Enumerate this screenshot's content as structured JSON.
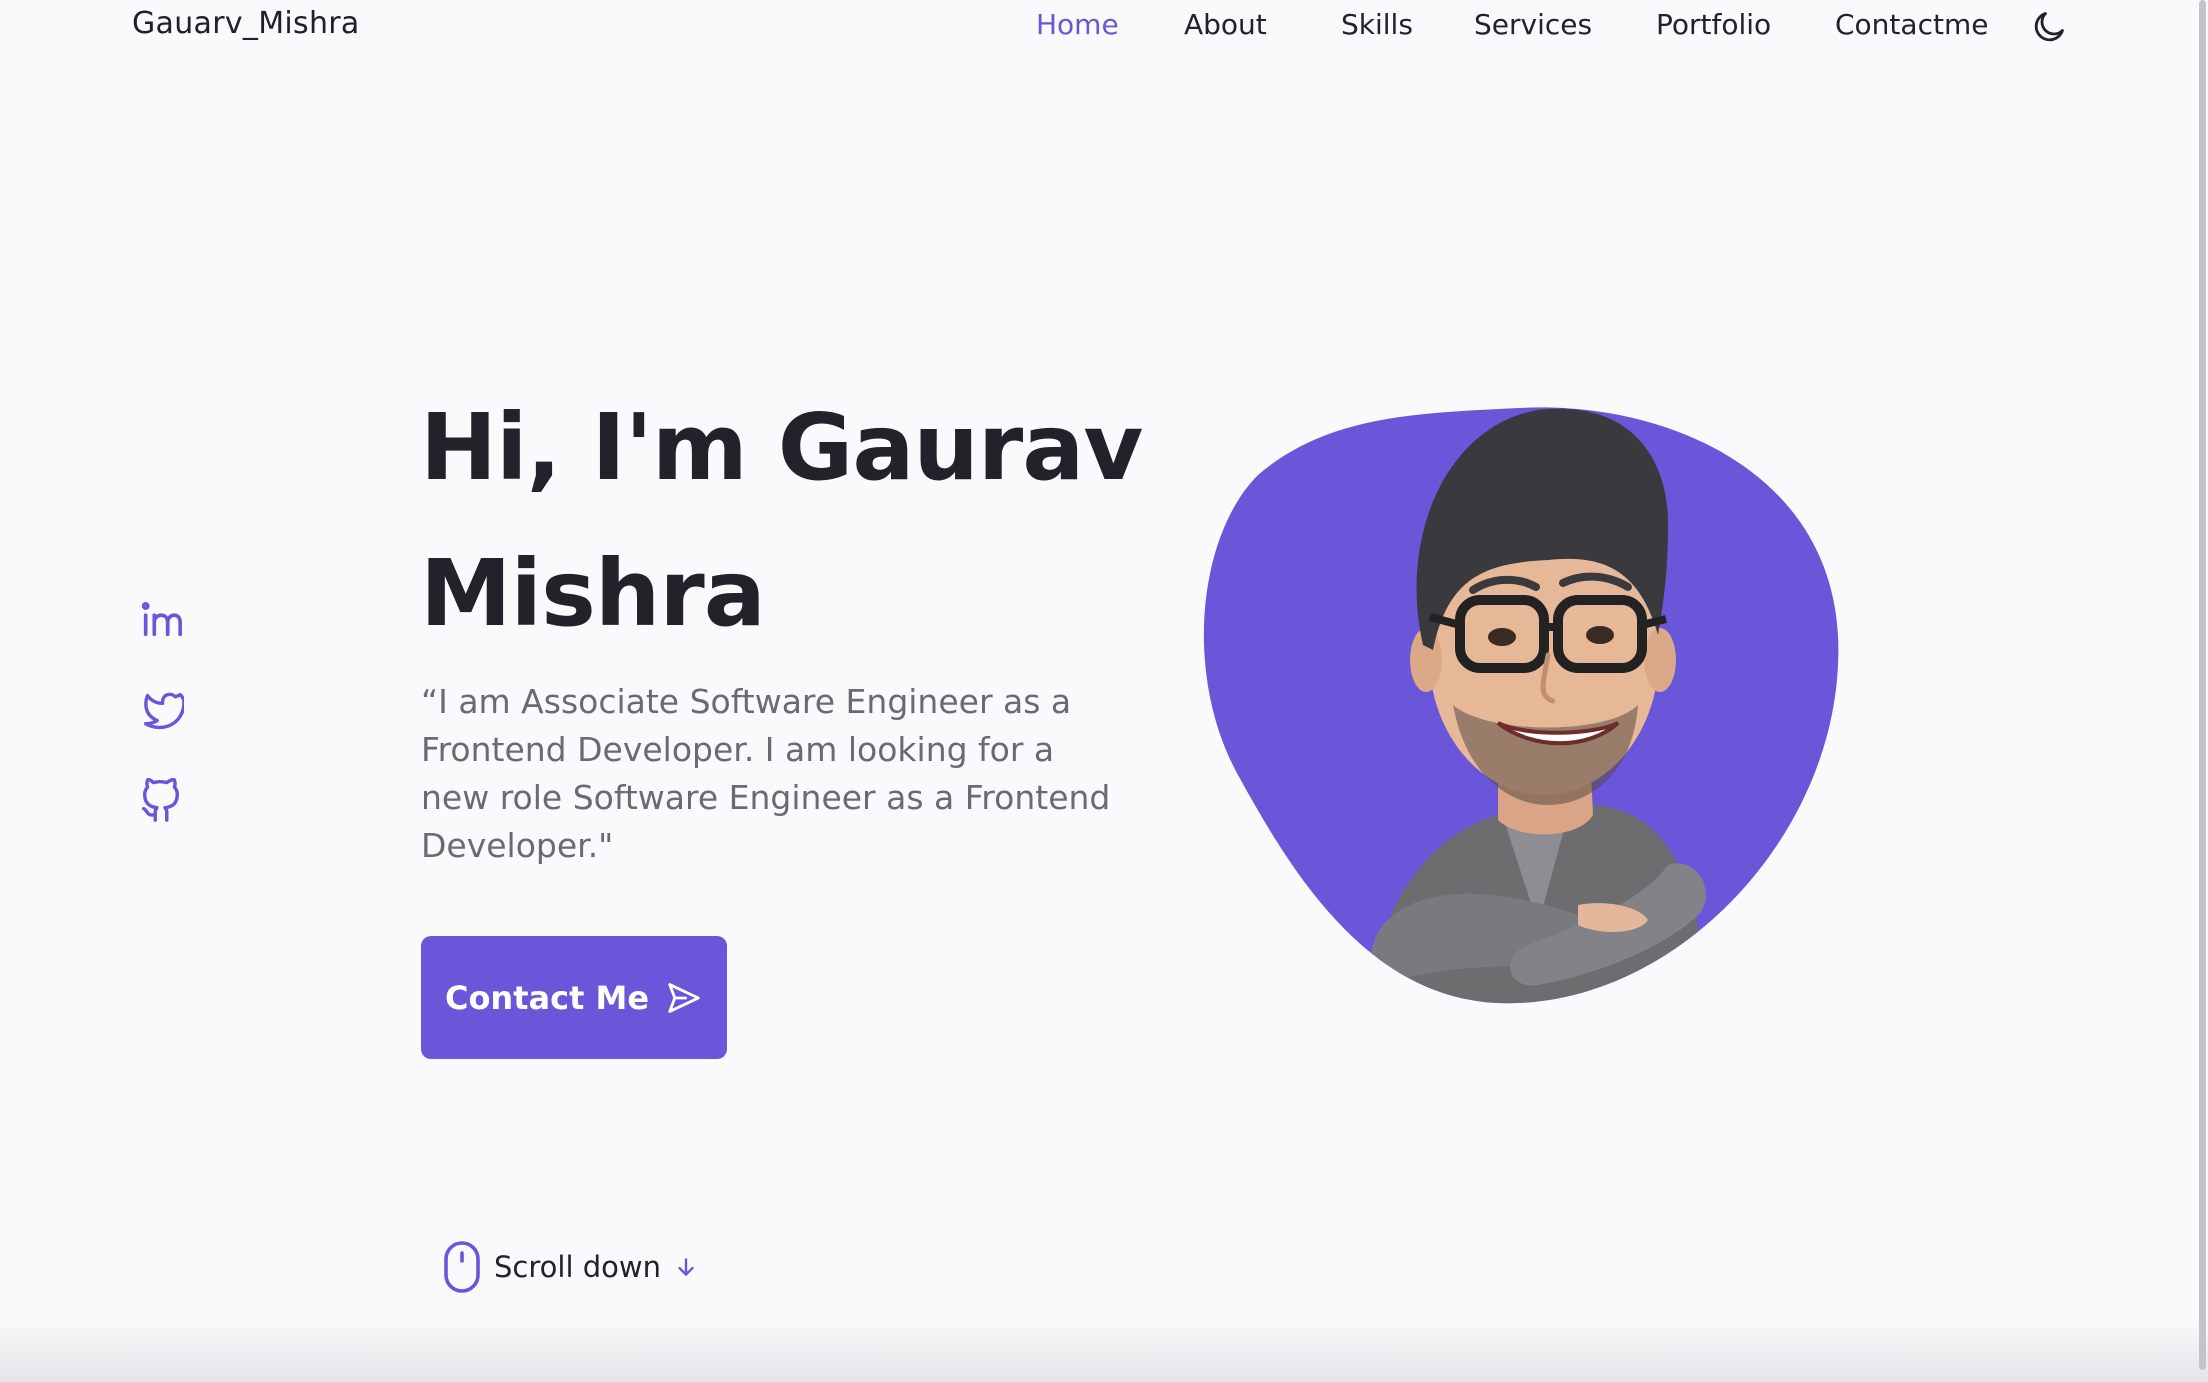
{
  "header": {
    "logo": "Gauarv_Mishra",
    "nav": [
      {
        "label": "Home",
        "active": true
      },
      {
        "label": "About",
        "active": false
      },
      {
        "label": "Skills",
        "active": false
      },
      {
        "label": "Services",
        "active": false
      },
      {
        "label": "Portfolio",
        "active": false
      },
      {
        "label": "Contactme",
        "active": false
      }
    ],
    "theme_toggle_icon": "moon-icon"
  },
  "social": [
    {
      "icon": "linkedin-icon"
    },
    {
      "icon": "twitter-icon"
    },
    {
      "icon": "github-icon"
    }
  ],
  "hero": {
    "title": "Hi, I'm Gaurav Mishra",
    "description": "“I am Associate Software Engineer as a Frontend Developer. I am looking for a new role Software Engineer as a Frontend Developer.\"",
    "button_label": "Contact Me",
    "button_icon": "send-icon",
    "image_icon": "avatar-image"
  },
  "scroll": {
    "label": "Scroll down",
    "mouse_icon": "mouse-icon",
    "arrow_icon": "arrow-down-icon"
  },
  "colors": {
    "accent": "#6a56d8",
    "background": "#fafafc",
    "text": "#22222a",
    "muted_text": "#6a6a76"
  }
}
